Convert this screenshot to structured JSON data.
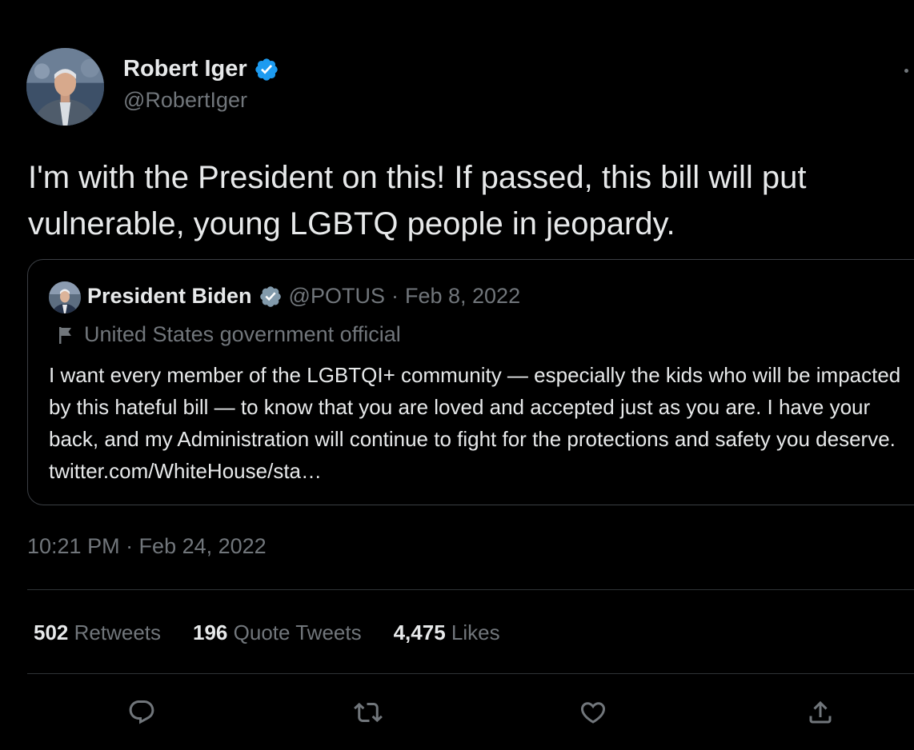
{
  "author": {
    "name": "Robert Iger",
    "handle": "@RobertIger",
    "verified": true
  },
  "tweet": {
    "text": "I'm with the President on this! If passed, this bill will put vulnerable, young LGBTQ people in jeopardy.",
    "timestamp": "10:21 PM · Feb 24, 2022"
  },
  "quoted": {
    "name": "President Biden",
    "handle": "@POTUS",
    "separator": "·",
    "date": "Feb 8, 2022",
    "label": "United States government official",
    "text": "I want every member of the LGBTQI+ community — especially the kids who will be impacted by this hateful bill — to know that you are loved and accepted just as you are. I have your back, and my Administration will continue to fight for the protections and safety you deserve. twitter.com/WhiteHouse/sta…"
  },
  "stats": {
    "retweets": {
      "count": "502",
      "label": "Retweets"
    },
    "quotes": {
      "count": "196",
      "label": "Quote Tweets"
    },
    "likes": {
      "count": "4,475",
      "label": "Likes"
    }
  },
  "actions": [
    {
      "icon": "reply-icon"
    },
    {
      "icon": "retweet-icon"
    },
    {
      "icon": "like-icon"
    },
    {
      "icon": "share-icon"
    }
  ],
  "colors": {
    "background": "#000000",
    "text_primary": "#e7e9ea",
    "text_secondary": "#71767b",
    "verified_badge": "#1d9bf0",
    "border": "#2f3336"
  }
}
